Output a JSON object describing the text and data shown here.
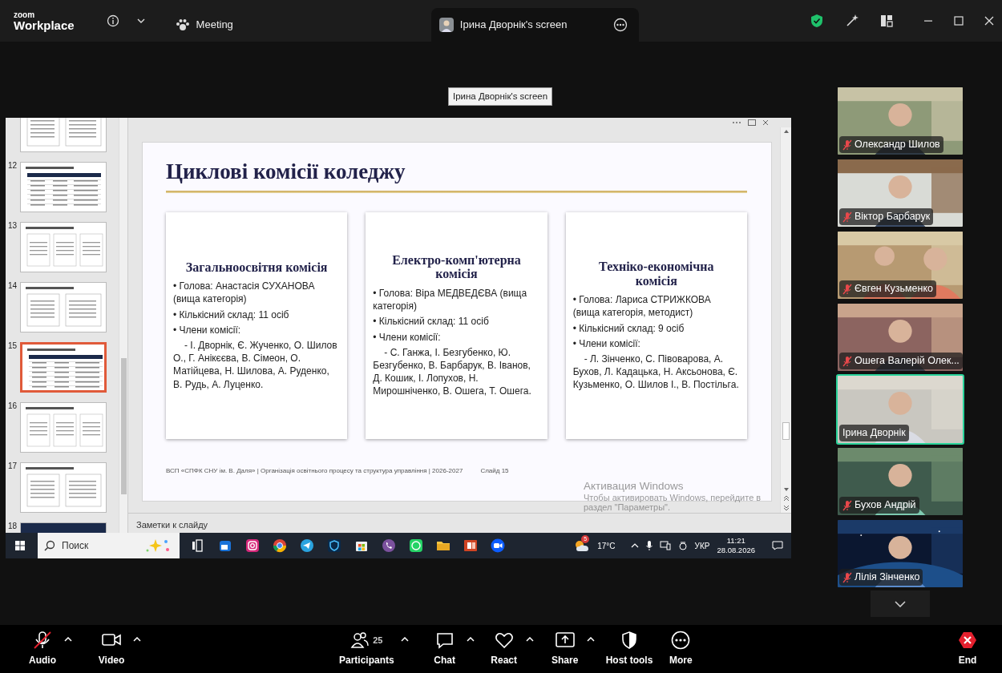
{
  "window": {
    "logo_small": "zoom",
    "logo": "Workplace",
    "tabs": [
      {
        "kind": "meeting",
        "label": "Meeting",
        "selected": false
      },
      {
        "kind": "screen",
        "label": "Ірина Дворнік's screen",
        "selected": true
      }
    ],
    "tooltip": "Ірина Дворнік's screen"
  },
  "shared_screen": {
    "thumbnails": [
      {
        "kind": "light",
        "selected": false
      },
      {
        "kind": "light",
        "number": "12",
        "selected": false
      },
      {
        "kind": "light",
        "number": "13",
        "selected": false
      },
      {
        "kind": "light",
        "number": "14",
        "selected": false
      },
      {
        "kind": "light",
        "number": "15",
        "selected": true
      },
      {
        "kind": "light",
        "number": "16",
        "selected": false
      },
      {
        "kind": "light",
        "number": "17",
        "selected": false
      },
      {
        "kind": "dark",
        "number": "18",
        "selected": false
      }
    ],
    "slide": {
      "title": "Циклові комісії коледжу",
      "cards": [
        {
          "heading": "Загальноосвітня комісія",
          "bullets": [
            "• Голова: Анастасія СУХАНОВА (вища категорія)",
            "• Кількісний склад: 11 осіб",
            "• Члени комісії:"
          ],
          "members": "- І. Дворнік, Є. Жученко, О. Шилов О., Г. Анікєєва, В. Сімеон, О. Матійцева, Н. Шилова, А. Руденко, В. Рудь, А. Луценко."
        },
        {
          "heading": "Електро-комп'ютерна комісія",
          "bullets": [
            "• Голова: Віра МЕДВЕДЄВА (вища категорія)",
            "• Кількісний склад: 11 осіб",
            "• Члени комісії:"
          ],
          "members": "- С. Ганжа, І. Безгубенко, Ю. Безгубенко, В. Барбарук, В. Іванов, Д. Кошик, І. Лопухов, Н. Мирошніченко, В. Ошега, Т. Ошега."
        },
        {
          "heading": "Техніко-економічна комісія",
          "bullets": [
            "• Голова: Лариса СТРИЖКОВА (вища категорія, методист)",
            "• Кількісний склад: 9 осіб",
            "• Члени комісії:"
          ],
          "members": "- Л. Зінченко, С. Півоварова, А. Бухов, Л. Кадацька, Н. Аксьонова, Є. Кузьменко, О. Шилов І., В. Постільга."
        }
      ],
      "footer": "ВСП «СПФК СНУ ім. В. Даля»  |  Організація освітнього процесу та структура управління  |  2026-2027",
      "slide_label": "Слайд 15"
    },
    "activation_title": "Активация Windows",
    "activation_text": "Чтобы активировать Windows, перейдите в раздел \"Параметры\".",
    "notes_placeholder": "Заметки к слайду",
    "taskbar": {
      "search_placeholder": "Поиск",
      "apps": [
        {
          "kind": "taskview"
        },
        {
          "kind": "mail"
        },
        {
          "kind": "camera"
        },
        {
          "kind": "browser"
        },
        {
          "kind": "plane"
        },
        {
          "kind": "shield"
        },
        {
          "kind": "store"
        },
        {
          "kind": "phone"
        },
        {
          "kind": "chat"
        },
        {
          "kind": "folder"
        },
        {
          "kind": "slides"
        },
        {
          "kind": "zoom"
        }
      ],
      "weather_badge": "5",
      "temperature": "17°C",
      "language": "УКР",
      "time": "11:21",
      "date": "28.08.2026"
    }
  },
  "participants": [
    {
      "name": "Олександр Шилов",
      "muted": true,
      "active": false
    },
    {
      "name": "Віктор Барбарук",
      "muted": true,
      "active": false
    },
    {
      "name": "Євген Кузьменко",
      "muted": true,
      "active": false
    },
    {
      "name": "Ошега Валерій Олек...",
      "muted": true,
      "active": false
    },
    {
      "name": "Ірина Дворнік",
      "muted": false,
      "active": true
    },
    {
      "name": "Бухов Андрій",
      "muted": true,
      "active": false
    },
    {
      "name": "Лілія Зінченко",
      "muted": true,
      "active": false
    }
  ],
  "toolbar": [
    {
      "kind": "audio",
      "label": "Audio",
      "muted": true,
      "caret": true
    },
    {
      "kind": "video",
      "label": "Video",
      "caret": true
    },
    {
      "kind": "participants",
      "label": "Participants",
      "count": "25",
      "caret": true
    },
    {
      "kind": "chat",
      "label": "Chat",
      "caret": true
    },
    {
      "kind": "react",
      "label": "React",
      "caret": true
    },
    {
      "kind": "share",
      "label": "Share",
      "caret": true
    },
    {
      "kind": "host",
      "label": "Host tools",
      "caret": false
    },
    {
      "kind": "more",
      "label": "More",
      "caret": false
    },
    {
      "kind": "end",
      "label": "End",
      "caret": false
    }
  ]
}
